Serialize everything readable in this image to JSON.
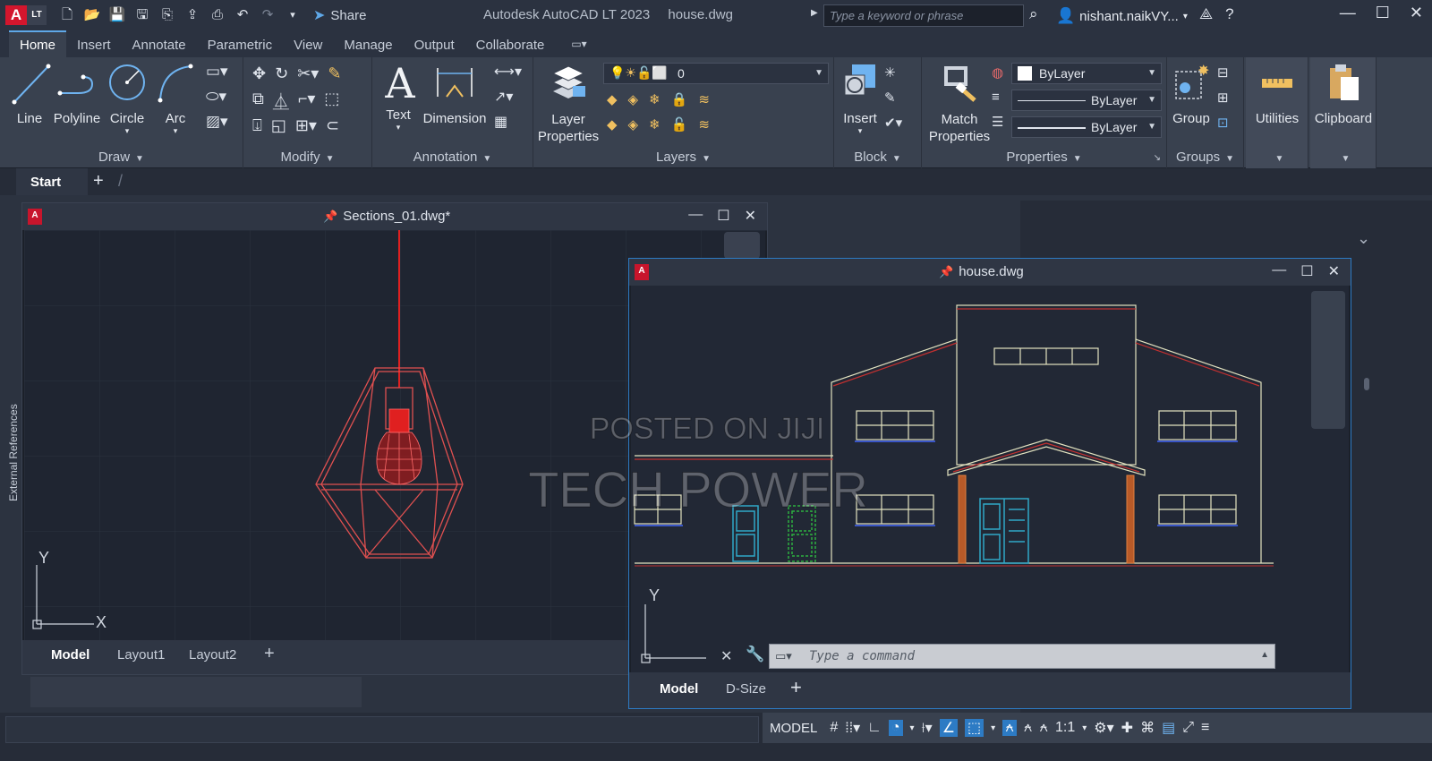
{
  "app": {
    "logo_letter": "A",
    "logo_badge": "LT",
    "title": "Autodesk AutoCAD LT 2023",
    "file": "house.dwg",
    "share_label": "Share",
    "search_placeholder": "Type a keyword or phrase",
    "user": "nishant.naikVY..."
  },
  "ribbon": {
    "tabs": [
      "Home",
      "Insert",
      "Annotate",
      "Parametric",
      "View",
      "Manage",
      "Output",
      "Collaborate"
    ],
    "draw": {
      "title": "Draw",
      "tools": [
        "Line",
        "Polyline",
        "Circle",
        "Arc"
      ]
    },
    "modify": {
      "title": "Modify"
    },
    "annotation": {
      "title": "Annotation",
      "text": "Text",
      "dimension": "Dimension"
    },
    "layers": {
      "title": "Layers",
      "layer_properties": "Layer\nProperties",
      "current_layer": "0"
    },
    "block": {
      "title": "Block",
      "insert": "Insert"
    },
    "properties": {
      "title": "Properties",
      "match": "Match\nProperties",
      "color": "ByLayer",
      "linetype": "ByLayer",
      "lineweight": "ByLayer"
    },
    "groups": {
      "title": "Groups",
      "group": "Group"
    },
    "utilities": {
      "title": "Utilities"
    },
    "clipboard": {
      "title": "Clipboard"
    }
  },
  "doc_tabs": {
    "start": "Start"
  },
  "sections_window": {
    "title": "Sections_01.dwg*",
    "layout_tabs": [
      "Model",
      "Layout1",
      "Layout2"
    ]
  },
  "house_window": {
    "title": "house.dwg",
    "layout_tabs": [
      "Model",
      "D-Size"
    ],
    "command_placeholder": "Type a command"
  },
  "side_panel": {
    "label": "External References"
  },
  "axes": {
    "x": "X",
    "y": "Y"
  },
  "status": {
    "model": "MODEL",
    "scale": "1:1"
  },
  "watermark": {
    "line1": "POSTED ON JIJI",
    "line2": "TECH POWER"
  }
}
